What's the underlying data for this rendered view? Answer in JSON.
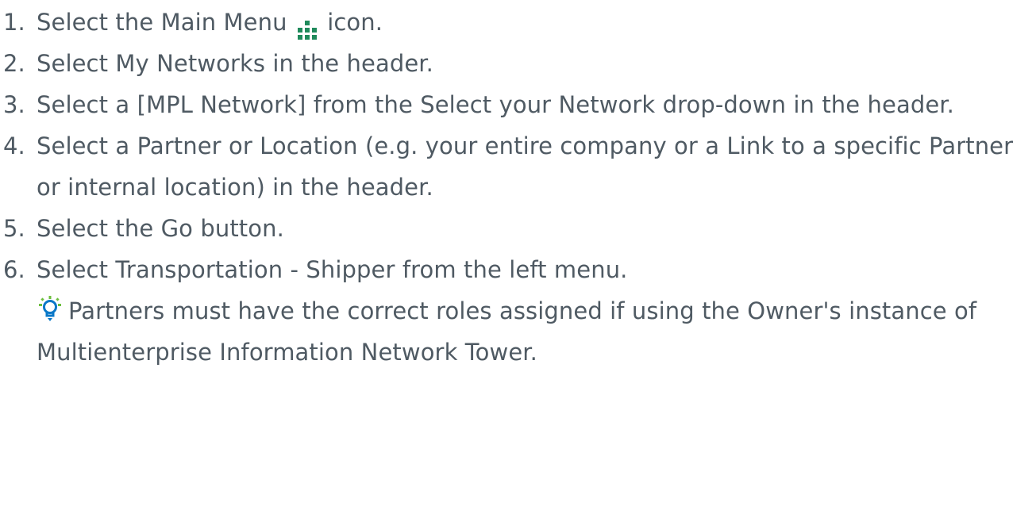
{
  "steps": [
    {
      "number": "1.",
      "text_before_icon": "Select the Main Menu ",
      "icon": "main-menu-grid-icon",
      "text_after_icon": " icon."
    },
    {
      "number": "2.",
      "text": "Select My Networks in the header."
    },
    {
      "number": "3.",
      "text": "Select a [MPL Network] from the Select your Network drop-down in the header."
    },
    {
      "number": "4.",
      "text": "Select a Partner or Location (e.g. your entire company or a Link to a specific Partner or internal location) in the header."
    },
    {
      "number": "5.",
      "text": "Select the Go button."
    },
    {
      "number": "6.",
      "text": " Select Transportation - Shipper from the left menu.",
      "tip": {
        "icon": "lightbulb-tip-icon",
        "text": "Partners must have the correct roles assigned if using the Owner's instance of Multienterprise Information Network Tower."
      }
    }
  ],
  "colors": {
    "text": "#4f5a63",
    "menu_icon": "#1f8a5b",
    "tip_icon_bulb": "#0a78c8",
    "tip_icon_rays": "#6cbf3e"
  }
}
